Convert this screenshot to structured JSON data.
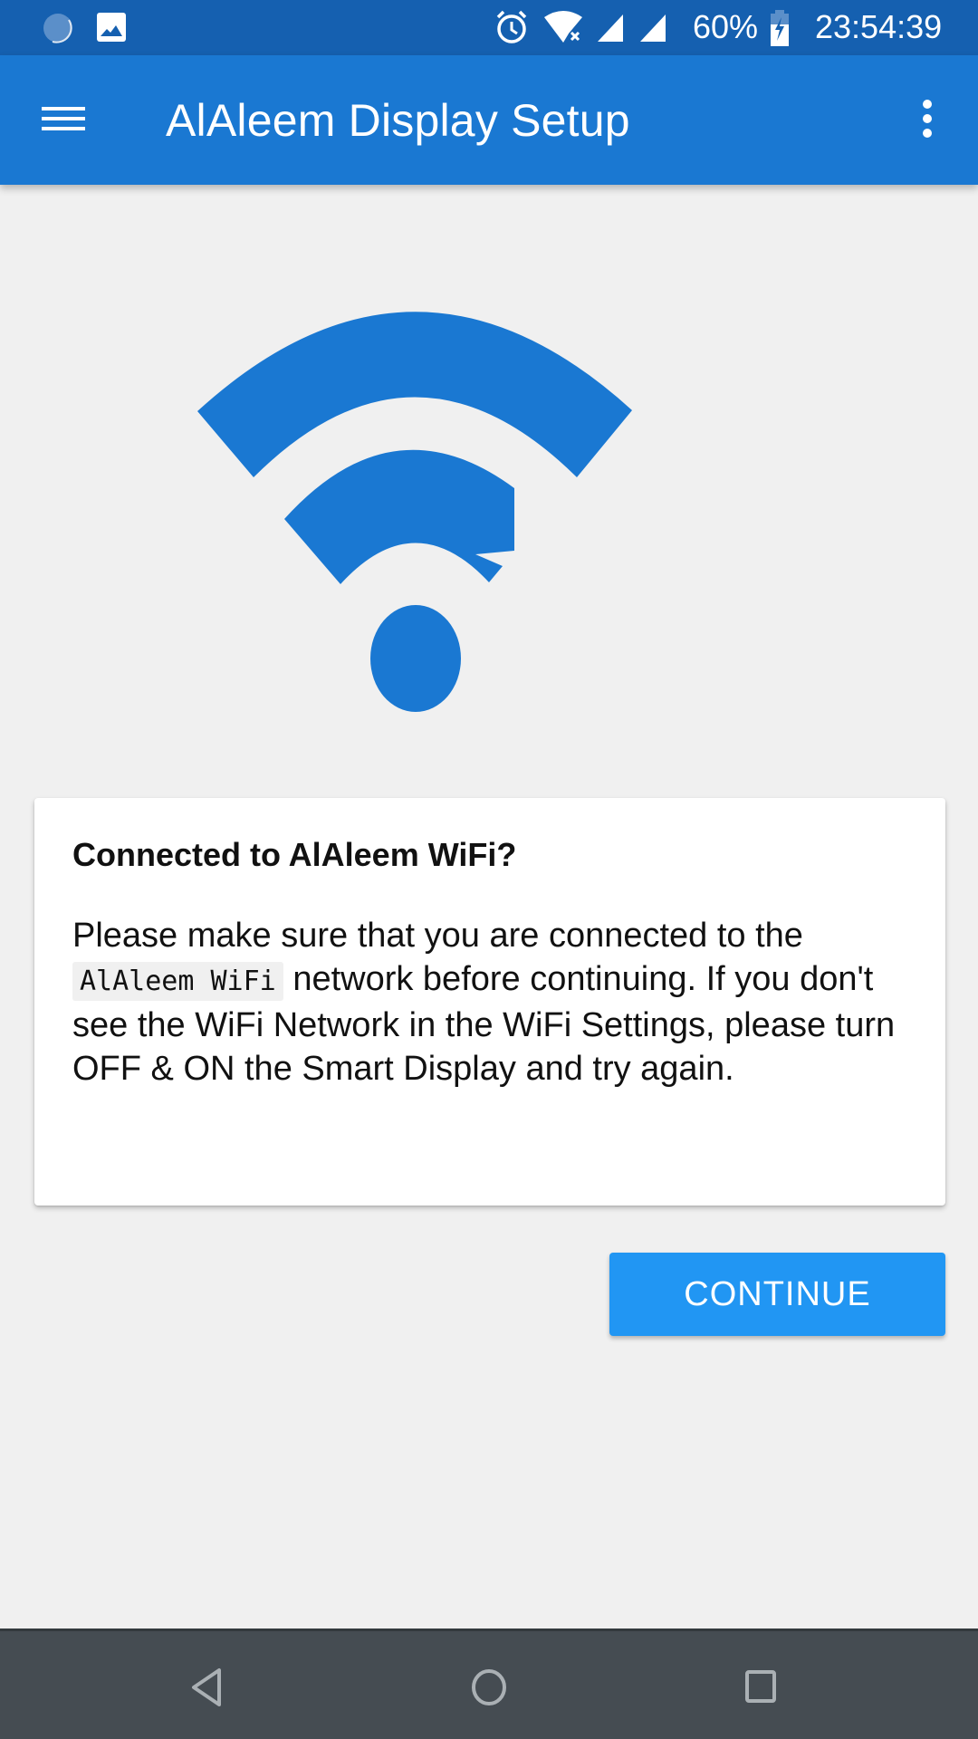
{
  "status_bar": {
    "left_icons": [
      "sync-icon",
      "image-notification-icon"
    ],
    "right_icons": [
      "alarm-icon",
      "wifi-no-internet-icon",
      "cell-signal-icon",
      "cell-signal-icon",
      "battery-charging-icon"
    ],
    "battery_percent": "60%",
    "time": "23:54:39"
  },
  "app_bar": {
    "title": "AlAleem Display Setup",
    "menu_icon": "hamburger-menu-icon",
    "overflow_icon": "more-vert-icon"
  },
  "hero": {
    "icon": "wifi-icon",
    "color": "#1a78d2"
  },
  "card": {
    "title": "Connected to AlAleem WiFi?",
    "body_before": "Please make sure that you are connected to the",
    "network_name": "AlAleem WiFi",
    "body_after": "network before continuing. If you don't see the WiFi Network in the WiFi Settings, please turn OFF & ON the Smart Display and try again."
  },
  "actions": {
    "continue_label": "CONTINUE",
    "accent": "#2196f3"
  },
  "nav_bar": {
    "back_icon": "back-icon",
    "home_icon": "home-icon",
    "recents_icon": "recents-icon"
  }
}
